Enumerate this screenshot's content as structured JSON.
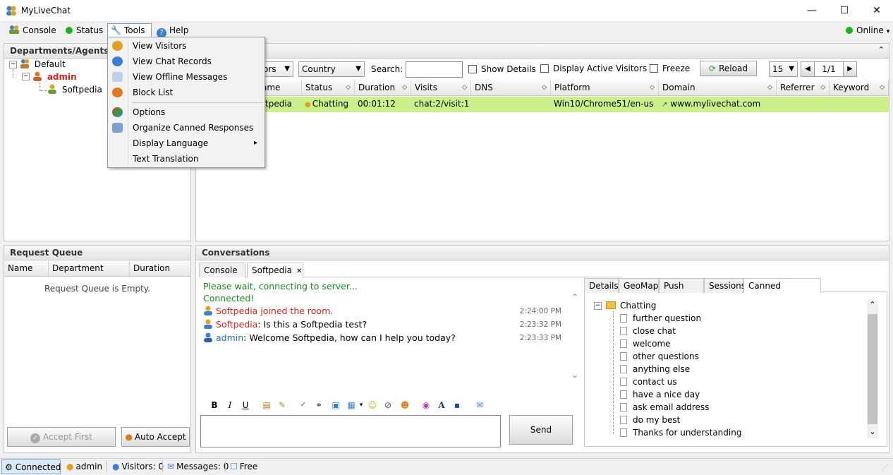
{
  "window": {
    "title": "MyLiveChat",
    "minimize": "—",
    "maximize": "☐",
    "close": "✕"
  },
  "menubar": {
    "console": "Console",
    "status": "Status",
    "tools": "Tools",
    "help": "Help",
    "online": "Online"
  },
  "tools_menu": {
    "items": [
      "View Visitors",
      "View Chat Records",
      "View Offline Messages",
      "Block List",
      "Options",
      "Organize Canned Responses",
      "Display Language",
      "Text Translation"
    ],
    "submenu_arrow": "▸"
  },
  "departments": {
    "title": "Departments/Agents",
    "default": "Default",
    "admin": "admin",
    "agent": "Softpedia",
    "expander": "−"
  },
  "visitors": {
    "filter_partial": "ors",
    "country": "Country",
    "search_label": "Search:",
    "search_value": "",
    "show_details": "Show Details",
    "display_active": "Display Active Visitors",
    "freeze": "Freeze",
    "reload": "Reload",
    "page_size": "15",
    "page": "1/1",
    "prev": "◀",
    "next": "▶",
    "collapse": "⌃",
    "columns": [
      "ame",
      "Status",
      "Duration",
      "Visits",
      "DNS",
      "Platform",
      "Domain",
      "Referrer",
      "Keyword"
    ],
    "row": {
      "name": "ftpedia",
      "status": "Chatting",
      "duration": "00:01:12",
      "visits": "chat:2/visit:1",
      "dns": "",
      "platform": "Win10/Chrome51/en-us",
      "domain": "www.mylivechat.com",
      "referrer": "",
      "keyword": ""
    }
  },
  "queue": {
    "title": "Request Queue",
    "columns": [
      "Name",
      "Department",
      "Duration"
    ],
    "empty": "Request Queue is Empty.",
    "accept_first": "Accept First",
    "auto_accept": "Auto Accept"
  },
  "conversations": {
    "title": "Conversations",
    "tabs": [
      "Console",
      "Softpedia"
    ],
    "tab_close": "✕",
    "messages": [
      {
        "text": "Please wait, connecting to server...",
        "color": "#1a8a1a"
      },
      {
        "text": "Connected!",
        "color": "#1a8a1a"
      }
    ],
    "chat": [
      {
        "who": "Softpedia joined the room.",
        "text": "",
        "time": "2:24:00 PM",
        "color": "#e0201a"
      },
      {
        "who": "Softpedia",
        "text": ":  Is this a Softpedia test?",
        "time": "2:23:32 PM",
        "color": "#e0201a"
      },
      {
        "who": "admin",
        "text": ":  Welcome Softpedia, how can I help you today?",
        "time": "2:23:33 PM",
        "color": "#2a6fb8"
      }
    ],
    "toolbar": {
      "bold": "B",
      "italic": "I",
      "underline": "U",
      "dropdown": "▾"
    },
    "send": "Send",
    "input_value": ""
  },
  "right_tabs": [
    "Details",
    "GeoMap",
    "Push URL",
    "Sessions",
    "Canned messages"
  ],
  "canned": {
    "folder": "Chatting",
    "folder_expander": "−",
    "items": [
      "further question",
      "close chat",
      "welcome",
      "other questions",
      "anything else",
      "contact us",
      "have a nice day",
      "ask email address",
      "do my best",
      "Thanks for understanding"
    ]
  },
  "statusbar": {
    "connected": "Connected",
    "user": "admin",
    "visitors": "Visitors: 0",
    "messages": "Messages: 0",
    "free": "Free"
  },
  "scroll": {
    "up": "⌃",
    "down": "⌄"
  },
  "colors": {
    "row_highlight": "#ccf08a",
    "online_green": "#1db01d",
    "admin_red": "#e0201a",
    "admin_blue": "#2a6fb8"
  }
}
